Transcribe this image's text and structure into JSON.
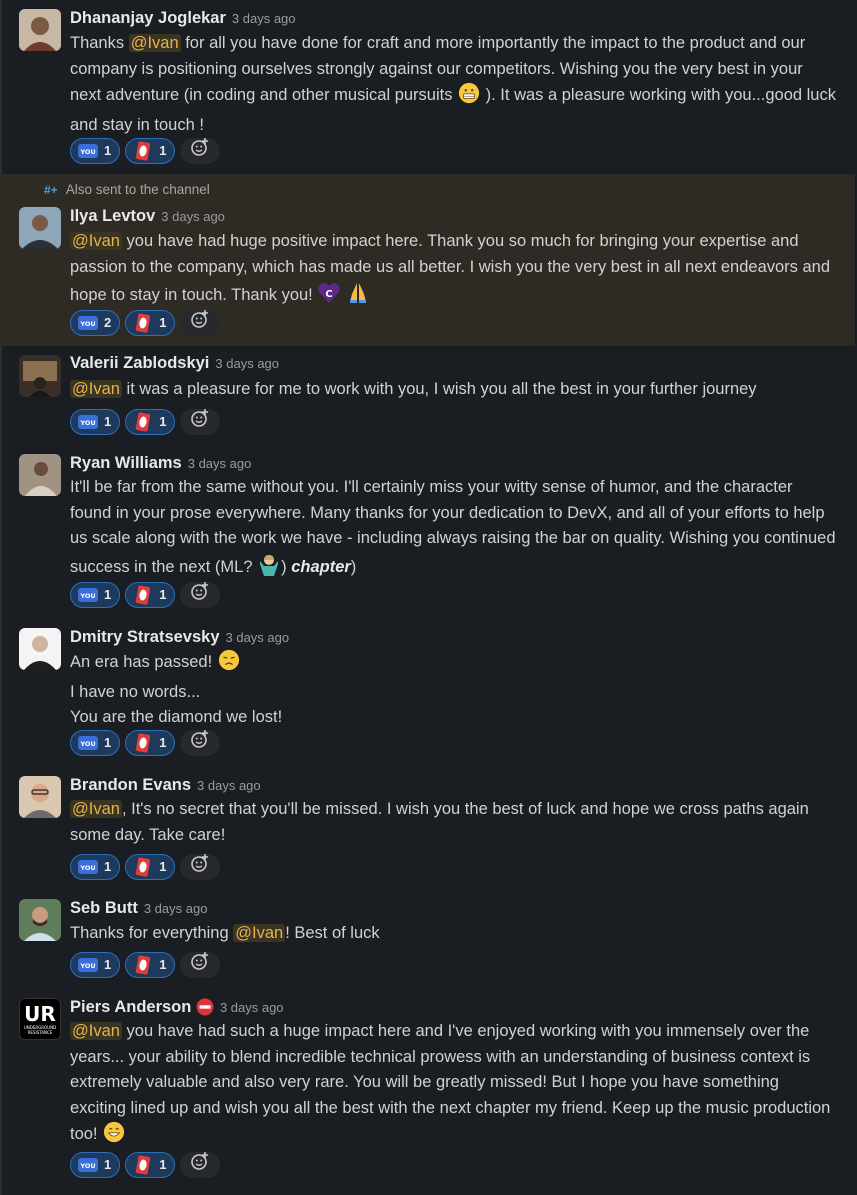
{
  "timestamp": "3 days ago",
  "also_sent": "Also sent to the channel",
  "mention": "@Ivan",
  "reaction_icons": {
    "first": "thank-you-emoji",
    "second": "card-emoji",
    "add": "add-reaction-icon"
  },
  "colors": {
    "background": "#1a1d21",
    "highlight": "#2d2b24",
    "mention": "#e8b24a",
    "pill": "#1d3a5c"
  },
  "messages": [
    {
      "name": "Dhananjay Joglekar",
      "parts": [
        "Thanks ",
        " for all you have done for craft and more importantly the impact to the product and our company is positioning ourselves strongly against our competitors. Wishing you the very best in your next adventure (in coding and other musical pursuits ",
        " ). It was a pleasure working with you...good luck and stay in touch !"
      ],
      "reactions": [
        "1",
        "1"
      ]
    },
    {
      "name": "Ilya Levtov",
      "parts": [
        " you have had huge positive impact here.  Thank you so much for bringing your expertise and passion to the company, which has made us all better.  I wish you the very best in all next endeavors and hope to stay in touch.  Thank you! "
      ],
      "reactions": [
        "2",
        "1"
      ]
    },
    {
      "name": "Valerii Zablodskyi",
      "parts": [
        " it was a pleasure for me to work with you, I wish you all the best in your further journey"
      ],
      "reactions": [
        "1",
        "1"
      ]
    },
    {
      "name": "Ryan Williams",
      "parts": [
        "It'll be far from the same without you. I'll certainly miss your witty sense of humor, and the character found in your prose everywhere. Many thanks for your dedication to DevX, and all of your efforts to help us scale along with the work we have - including always raising the bar on quality. Wishing you continued success in the next (ML? ",
        ") ",
        "chapter",
        ")"
      ],
      "reactions": [
        "1",
        "1"
      ]
    },
    {
      "name": "Dmitry Stratsevsky",
      "lines": [
        "An era has passed! ",
        "I have no words...",
        "You are the diamond we lost!"
      ],
      "reactions": [
        "1",
        "1"
      ]
    },
    {
      "name": "Brandon Evans",
      "parts": [
        ", It's no secret that you'll be missed. I wish you the best of luck and hope we cross paths again some day. Take care!"
      ],
      "reactions": [
        "1",
        "1"
      ]
    },
    {
      "name": "Seb Butt",
      "parts": [
        "Thanks for everything ",
        "! Best of luck"
      ],
      "reactions": [
        "1",
        "1"
      ]
    },
    {
      "name": "Piers Anderson",
      "avatar_text": "UR",
      "avatar_subtext": "UNDERGROUND RESISTANCE",
      "parts": [
        " you have had such a huge impact here and I've enjoyed working with you immensely over the years... your ability to blend incredible technical prowess with an understanding of business context is extremely valuable and also very rare. You will be greatly missed! But I hope you have something exciting lined up and wish you all the best with the next chapter my friend. Keep up the music production too! "
      ],
      "reactions": [
        "1",
        "1"
      ]
    }
  ]
}
